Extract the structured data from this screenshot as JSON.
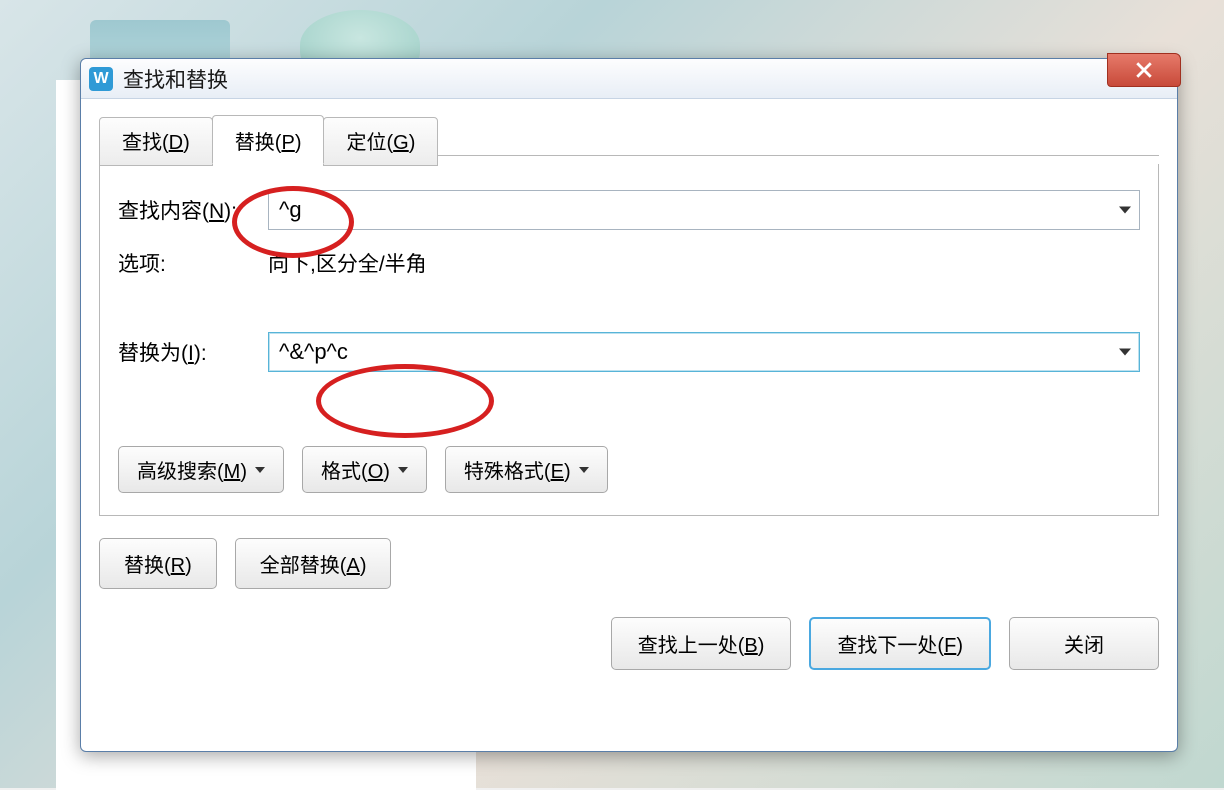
{
  "dialog": {
    "title": "查找和替换",
    "app_icon_letter": "W"
  },
  "tabs": {
    "find": "查找(",
    "find_key": "D",
    "find_suffix": ")",
    "replace": "替换(",
    "replace_key": "P",
    "replace_suffix": ")",
    "goto": "定位(",
    "goto_key": "G",
    "goto_suffix": ")"
  },
  "fields": {
    "find_label_prefix": "查找内容(",
    "find_label_key": "N",
    "find_label_suffix": "):",
    "find_value": "^g",
    "options_label": "选项:",
    "options_value": "向下,区分全/半角",
    "replace_label_prefix": "替换为(",
    "replace_label_key": "I",
    "replace_label_suffix": "):",
    "replace_value": "^&^p^c"
  },
  "adv_buttons": {
    "advanced_prefix": "高级搜索(",
    "advanced_key": "M",
    "advanced_suffix": ")",
    "format_prefix": "格式(",
    "format_key": "O",
    "format_suffix": ")",
    "special_prefix": "特殊格式(",
    "special_key": "E",
    "special_suffix": ")"
  },
  "mid_buttons": {
    "replace_prefix": "替换(",
    "replace_key": "R",
    "replace_suffix": ")",
    "replace_all_prefix": "全部替换(",
    "replace_all_key": "A",
    "replace_all_suffix": ")"
  },
  "footer_buttons": {
    "find_prev_prefix": "查找上一处(",
    "find_prev_key": "B",
    "find_prev_suffix": ")",
    "find_next_prefix": "查找下一处(",
    "find_next_key": "F",
    "find_next_suffix": ")",
    "close": "关闭"
  }
}
